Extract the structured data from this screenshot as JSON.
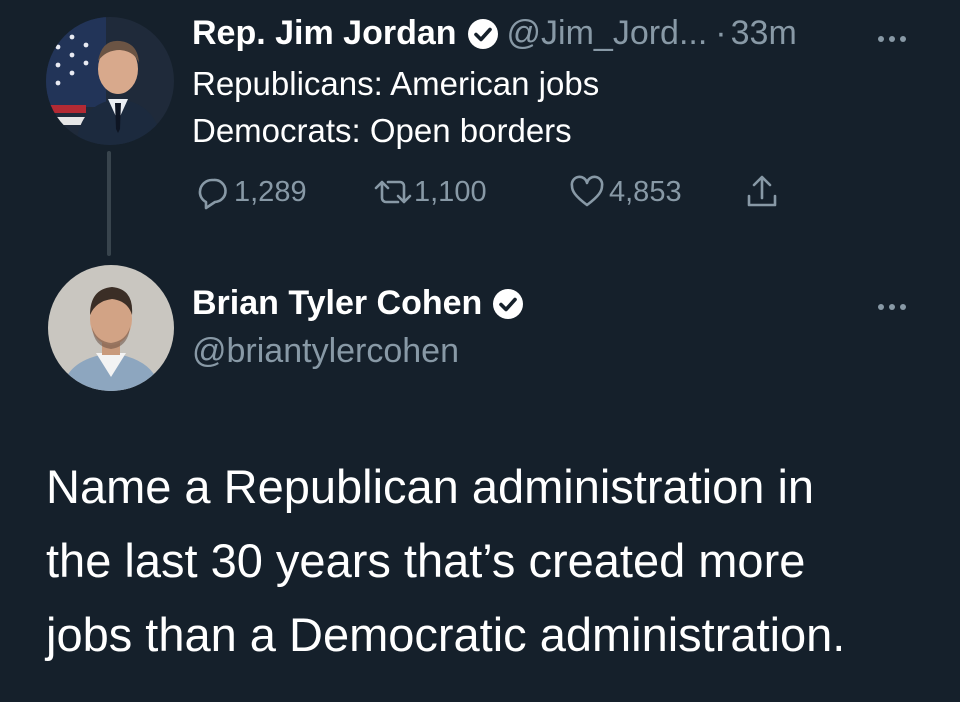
{
  "tweet_top": {
    "author_name": "Rep. Jim Jordan",
    "author_handle": "@Jim_Jord...",
    "separator": "·",
    "time": "33m",
    "text_lines": [
      "Republicans: American jobs",
      "Democrats: Open borders"
    ],
    "replies": "1,289",
    "retweets": "1,100",
    "likes": "4,853",
    "avatar_icon": "portrait-with-flag"
  },
  "tweet_reply": {
    "author_name": "Brian Tyler Cohen",
    "author_handle": "@briantylercohen",
    "text_lines": [
      "Name a Republican administration in",
      "the last 30 years that’s created more",
      "jobs than a Democratic administration."
    ],
    "avatar_icon": "portrait"
  },
  "colors": {
    "background": "#15202b",
    "text_primary": "#ffffff",
    "text_secondary": "#8899a6",
    "thread_line": "#38444d"
  }
}
